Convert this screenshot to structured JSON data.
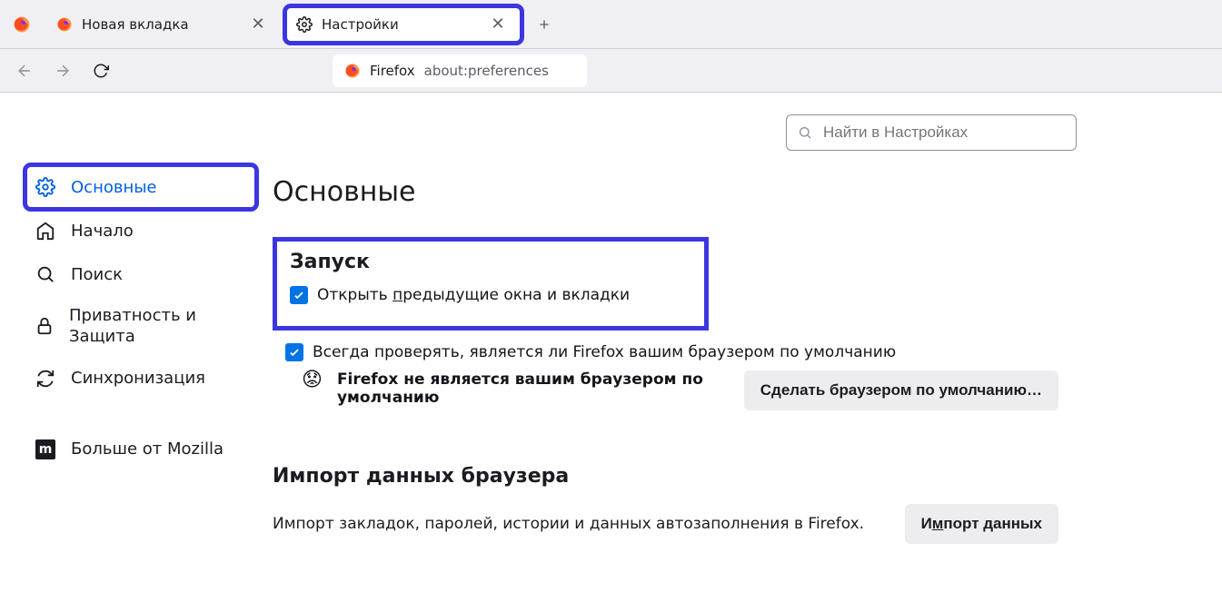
{
  "tabs": [
    {
      "label": "Новая вкладка",
      "icon": "firefox"
    },
    {
      "label": "Настройки",
      "icon": "gear"
    }
  ],
  "url": {
    "prefix": "Firefox",
    "rest": "about:preferences"
  },
  "search": {
    "placeholder": "Найти в Настройках"
  },
  "sidebar": {
    "items": [
      {
        "label": "Основные"
      },
      {
        "label": "Начало"
      },
      {
        "label": "Поиск"
      },
      {
        "label": "Приватность и Защита"
      },
      {
        "label": "Синхронизация"
      },
      {
        "label": "Больше от Mozilla"
      }
    ]
  },
  "page": {
    "title": "Основные",
    "startup": {
      "heading": "Запуск",
      "restore_pre": "Открыть ",
      "restore_key": "п",
      "restore_post": "редыдущие окна и вкладки",
      "check_pre": "Всег",
      "check_key": "д",
      "check_post": "а проверять, является ли Firefox вашим браузером по умолчанию",
      "not_default": "Firefox не является вашим браузером по умолчанию",
      "make_default_btn": "Сделать браузером по умолчанию…"
    },
    "import": {
      "heading": "Импорт данных браузера",
      "desc": "Импорт закладок, паролей, истории и данных автозаполнения в Firefox.",
      "btn_pre": "И",
      "btn_key": "м",
      "btn_post": "порт данных"
    }
  }
}
